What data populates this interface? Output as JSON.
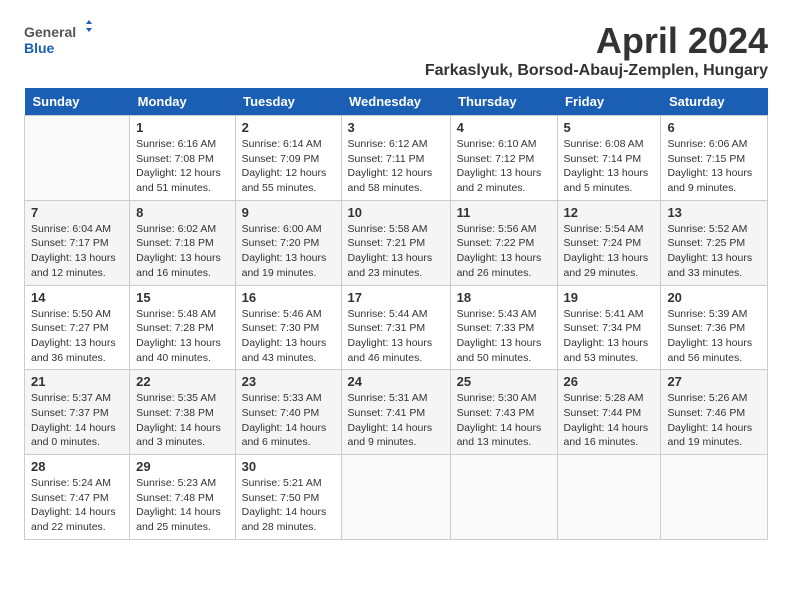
{
  "header": {
    "logo_general": "General",
    "logo_blue": "Blue",
    "month_title": "April 2024",
    "location": "Farkaslyuk, Borsod-Abauj-Zemplen, Hungary"
  },
  "columns": [
    "Sunday",
    "Monday",
    "Tuesday",
    "Wednesday",
    "Thursday",
    "Friday",
    "Saturday"
  ],
  "weeks": [
    [
      {
        "day": "",
        "info": ""
      },
      {
        "day": "1",
        "info": "Sunrise: 6:16 AM\nSunset: 7:08 PM\nDaylight: 12 hours\nand 51 minutes."
      },
      {
        "day": "2",
        "info": "Sunrise: 6:14 AM\nSunset: 7:09 PM\nDaylight: 12 hours\nand 55 minutes."
      },
      {
        "day": "3",
        "info": "Sunrise: 6:12 AM\nSunset: 7:11 PM\nDaylight: 12 hours\nand 58 minutes."
      },
      {
        "day": "4",
        "info": "Sunrise: 6:10 AM\nSunset: 7:12 PM\nDaylight: 13 hours\nand 2 minutes."
      },
      {
        "day": "5",
        "info": "Sunrise: 6:08 AM\nSunset: 7:14 PM\nDaylight: 13 hours\nand 5 minutes."
      },
      {
        "day": "6",
        "info": "Sunrise: 6:06 AM\nSunset: 7:15 PM\nDaylight: 13 hours\nand 9 minutes."
      }
    ],
    [
      {
        "day": "7",
        "info": "Sunrise: 6:04 AM\nSunset: 7:17 PM\nDaylight: 13 hours\nand 12 minutes."
      },
      {
        "day": "8",
        "info": "Sunrise: 6:02 AM\nSunset: 7:18 PM\nDaylight: 13 hours\nand 16 minutes."
      },
      {
        "day": "9",
        "info": "Sunrise: 6:00 AM\nSunset: 7:20 PM\nDaylight: 13 hours\nand 19 minutes."
      },
      {
        "day": "10",
        "info": "Sunrise: 5:58 AM\nSunset: 7:21 PM\nDaylight: 13 hours\nand 23 minutes."
      },
      {
        "day": "11",
        "info": "Sunrise: 5:56 AM\nSunset: 7:22 PM\nDaylight: 13 hours\nand 26 minutes."
      },
      {
        "day": "12",
        "info": "Sunrise: 5:54 AM\nSunset: 7:24 PM\nDaylight: 13 hours\nand 29 minutes."
      },
      {
        "day": "13",
        "info": "Sunrise: 5:52 AM\nSunset: 7:25 PM\nDaylight: 13 hours\nand 33 minutes."
      }
    ],
    [
      {
        "day": "14",
        "info": "Sunrise: 5:50 AM\nSunset: 7:27 PM\nDaylight: 13 hours\nand 36 minutes."
      },
      {
        "day": "15",
        "info": "Sunrise: 5:48 AM\nSunset: 7:28 PM\nDaylight: 13 hours\nand 40 minutes."
      },
      {
        "day": "16",
        "info": "Sunrise: 5:46 AM\nSunset: 7:30 PM\nDaylight: 13 hours\nand 43 minutes."
      },
      {
        "day": "17",
        "info": "Sunrise: 5:44 AM\nSunset: 7:31 PM\nDaylight: 13 hours\nand 46 minutes."
      },
      {
        "day": "18",
        "info": "Sunrise: 5:43 AM\nSunset: 7:33 PM\nDaylight: 13 hours\nand 50 minutes."
      },
      {
        "day": "19",
        "info": "Sunrise: 5:41 AM\nSunset: 7:34 PM\nDaylight: 13 hours\nand 53 minutes."
      },
      {
        "day": "20",
        "info": "Sunrise: 5:39 AM\nSunset: 7:36 PM\nDaylight: 13 hours\nand 56 minutes."
      }
    ],
    [
      {
        "day": "21",
        "info": "Sunrise: 5:37 AM\nSunset: 7:37 PM\nDaylight: 14 hours\nand 0 minutes."
      },
      {
        "day": "22",
        "info": "Sunrise: 5:35 AM\nSunset: 7:38 PM\nDaylight: 14 hours\nand 3 minutes."
      },
      {
        "day": "23",
        "info": "Sunrise: 5:33 AM\nSunset: 7:40 PM\nDaylight: 14 hours\nand 6 minutes."
      },
      {
        "day": "24",
        "info": "Sunrise: 5:31 AM\nSunset: 7:41 PM\nDaylight: 14 hours\nand 9 minutes."
      },
      {
        "day": "25",
        "info": "Sunrise: 5:30 AM\nSunset: 7:43 PM\nDaylight: 14 hours\nand 13 minutes."
      },
      {
        "day": "26",
        "info": "Sunrise: 5:28 AM\nSunset: 7:44 PM\nDaylight: 14 hours\nand 16 minutes."
      },
      {
        "day": "27",
        "info": "Sunrise: 5:26 AM\nSunset: 7:46 PM\nDaylight: 14 hours\nand 19 minutes."
      }
    ],
    [
      {
        "day": "28",
        "info": "Sunrise: 5:24 AM\nSunset: 7:47 PM\nDaylight: 14 hours\nand 22 minutes."
      },
      {
        "day": "29",
        "info": "Sunrise: 5:23 AM\nSunset: 7:48 PM\nDaylight: 14 hours\nand 25 minutes."
      },
      {
        "day": "30",
        "info": "Sunrise: 5:21 AM\nSunset: 7:50 PM\nDaylight: 14 hours\nand 28 minutes."
      },
      {
        "day": "",
        "info": ""
      },
      {
        "day": "",
        "info": ""
      },
      {
        "day": "",
        "info": ""
      },
      {
        "day": "",
        "info": ""
      }
    ]
  ]
}
